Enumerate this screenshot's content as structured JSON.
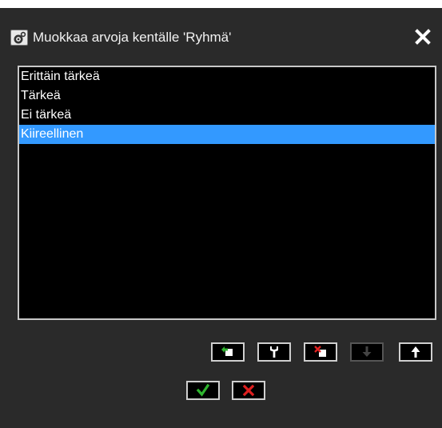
{
  "dialog": {
    "title": "Muokkaa arvoja kentälle 'Ryhmä'",
    "icons": {
      "title": "settings-gear-icon",
      "close": "close-icon"
    }
  },
  "list": {
    "items": [
      {
        "label": "Erittäin tärkeä",
        "selected": false
      },
      {
        "label": "Tärkeä",
        "selected": false
      },
      {
        "label": "Ei tärkeä",
        "selected": false
      },
      {
        "label": "Kiireellinen",
        "selected": true
      }
    ],
    "selected_color": "#3399ff"
  },
  "toolbar": {
    "buttons": [
      {
        "name": "add-value-button",
        "icon": "add-value-icon",
        "enabled": true
      },
      {
        "name": "rename-value-button",
        "icon": "wrench-icon",
        "enabled": true
      },
      {
        "name": "delete-value-button",
        "icon": "delete-value-icon",
        "enabled": true
      },
      {
        "name": "move-down-button",
        "icon": "arrow-down-icon",
        "enabled": false
      },
      {
        "name": "move-up-button",
        "icon": "arrow-up-icon",
        "enabled": true
      }
    ]
  },
  "actions": {
    "ok_icon": "checkmark-icon",
    "cancel_icon": "cross-icon",
    "ok_color": "#2fb52f",
    "cancel_color": "#e02020"
  }
}
